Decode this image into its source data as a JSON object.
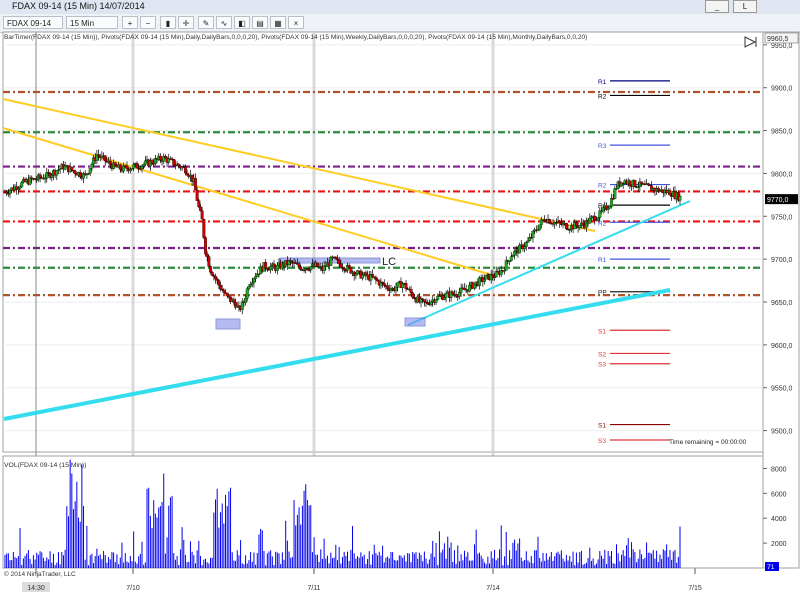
{
  "window": {
    "title": "FDAX 09-14 (15 Min)  14/07/2014",
    "title_icon": "chart-window-icon",
    "minimize_label": "_",
    "restore_label": "L"
  },
  "toolbar": {
    "instrument": "FDAX 09-14",
    "interval": "15 Min",
    "icons": [
      "instrument-dropdown-icon",
      "interval-dropdown-icon",
      "zoom-in-icon",
      "zoom-out-icon",
      "bar-type-icon",
      "crosshair-icon",
      "drawing-tools-icon",
      "indicators-icon",
      "strategies-icon",
      "data-box-icon",
      "properties-icon",
      "close-icon"
    ]
  },
  "colors": {
    "price_up": "#22aa22",
    "price_down": "#cc0000",
    "volume": "#0000ee",
    "trend_yellow": "#ffcc22",
    "trend_cyan": "#33ddee",
    "box_blue": "#7a85e8"
  },
  "chart_data": [
    {
      "type": "candlestick",
      "indicator_text": "BarTimer(FDAX 09-14 (15 Min)), Pivots(FDAX 09-14 (15 Min),Daily,DailyBars,0,0,0,20), Pivots(FDAX 09-14 (15 Min),Weekly,DailyBars,0,0,0,20), Pivots(FDAX 09-14 (15 Min),Monthly,DailyBars,0,0,20)",
      "y_ticks": [
        "9950,0",
        "9900,0",
        "9850,0",
        "9800,0",
        "9750,0",
        "9700,0",
        "9650,0",
        "9600,0",
        "9550,0",
        "9500,0"
      ],
      "ylim": [
        9475,
        9965
      ],
      "top_price_label": "9960,5",
      "current_price_label": "9770,0",
      "x_ticks": [
        "14:30",
        "7/10",
        "7/11",
        "7/14",
        "7/15"
      ],
      "session_separators": [
        "7/10",
        "7/11",
        "7/14"
      ],
      "price_path": [
        [
          0,
          9778
        ],
        [
          12,
          9790
        ],
        [
          25,
          9797
        ],
        [
          35,
          9808
        ],
        [
          48,
          9797
        ],
        [
          55,
          9822
        ],
        [
          65,
          9808
        ],
        [
          70,
          9805
        ],
        [
          82,
          9810
        ],
        [
          95,
          9818
        ],
        [
          108,
          9805
        ],
        [
          110,
          9800
        ],
        [
          113,
          9790
        ],
        [
          116,
          9760
        ],
        [
          118,
          9745
        ],
        [
          120,
          9710
        ],
        [
          123,
          9688
        ],
        [
          128,
          9670
        ],
        [
          133,
          9655
        ],
        [
          138,
          9648
        ],
        [
          140,
          9640
        ],
        [
          143,
          9650
        ],
        [
          146,
          9672
        ],
        [
          150,
          9682
        ],
        [
          155,
          9692
        ],
        [
          162,
          9690
        ],
        [
          170,
          9696
        ],
        [
          178,
          9690
        ],
        [
          186,
          9692
        ],
        [
          190,
          9688
        ],
        [
          196,
          9700
        ],
        [
          200,
          9695
        ],
        [
          206,
          9688
        ],
        [
          212,
          9682
        ],
        [
          220,
          9678
        ],
        [
          226,
          9670
        ],
        [
          232,
          9665
        ],
        [
          238,
          9672
        ],
        [
          244,
          9658
        ],
        [
          248,
          9650
        ],
        [
          252,
          9648
        ],
        [
          258,
          9655
        ],
        [
          264,
          9658
        ],
        [
          270,
          9660
        ],
        [
          276,
          9665
        ],
        [
          282,
          9672
        ],
        [
          288,
          9678
        ],
        [
          294,
          9682
        ],
        [
          298,
          9688
        ],
        [
          303,
          9705
        ],
        [
          308,
          9712
        ],
        [
          313,
          9720
        ],
        [
          318,
          9735
        ],
        [
          323,
          9748
        ],
        [
          330,
          9742
        ],
        [
          338,
          9738
        ],
        [
          346,
          9740
        ],
        [
          352,
          9748
        ],
        [
          356,
          9752
        ],
        [
          362,
          9765
        ],
        [
          366,
          9785
        ],
        [
          370,
          9792
        ],
        [
          376,
          9788
        ],
        [
          384,
          9784
        ],
        [
          392,
          9780
        ],
        [
          398,
          9778
        ],
        [
          404,
          9772
        ]
      ],
      "pivot_levels": [
        {
          "price": 9895,
          "color": "#b2522a"
        },
        {
          "price": 9848,
          "color": "#2e8b3c"
        },
        {
          "price": 9808,
          "color": "#7a1f8a"
        },
        {
          "price": 9779,
          "color": "#ee1111"
        },
        {
          "price": 9744,
          "color": "#ee1111"
        },
        {
          "price": 9713,
          "color": "#7a1f8a"
        },
        {
          "price": 9690,
          "color": "#2e8b3c"
        },
        {
          "price": 9658,
          "color": "#b2522a"
        }
      ],
      "pivot_labels": [
        {
          "text": "R1",
          "price": 9908,
          "color": "#000080"
        },
        {
          "text": "R2",
          "price": 9891,
          "color": "#000000"
        },
        {
          "text": "R3",
          "price": 9833,
          "color": "#4455dd"
        },
        {
          "text": "R2",
          "price": 9787,
          "color": "#4455dd"
        },
        {
          "text": "R1",
          "price": 9763,
          "color": "#000000"
        },
        {
          "text": "R2",
          "price": 9743,
          "color": "#4455dd"
        },
        {
          "text": "R1",
          "price": 9700,
          "color": "#4455dd"
        },
        {
          "text": "PP",
          "price": 9662,
          "color": "#222222"
        },
        {
          "text": "S1",
          "price": 9617,
          "color": "#dd3333"
        },
        {
          "text": "S2",
          "price": 9590,
          "color": "#dd3333"
        },
        {
          "text": "S3",
          "price": 9578,
          "color": "#dd3333"
        },
        {
          "text": "S1",
          "price": 9507,
          "color": "#880000"
        },
        {
          "text": "S3",
          "price": 9489,
          "color": "#dd3333"
        }
      ],
      "annotations": [
        {
          "text": "LC"
        }
      ],
      "time_remaining": "Time remaining = 00:00:00"
    },
    {
      "type": "bar",
      "title": "VOL(FDAX 09-14 (15 Min))",
      "y_ticks": [
        "8000",
        "6000",
        "4000",
        "2000"
      ],
      "ylim": [
        0,
        9000
      ],
      "last_value_label": "71",
      "copyright": "© 2014 NinjaTrader, LLC"
    }
  ]
}
